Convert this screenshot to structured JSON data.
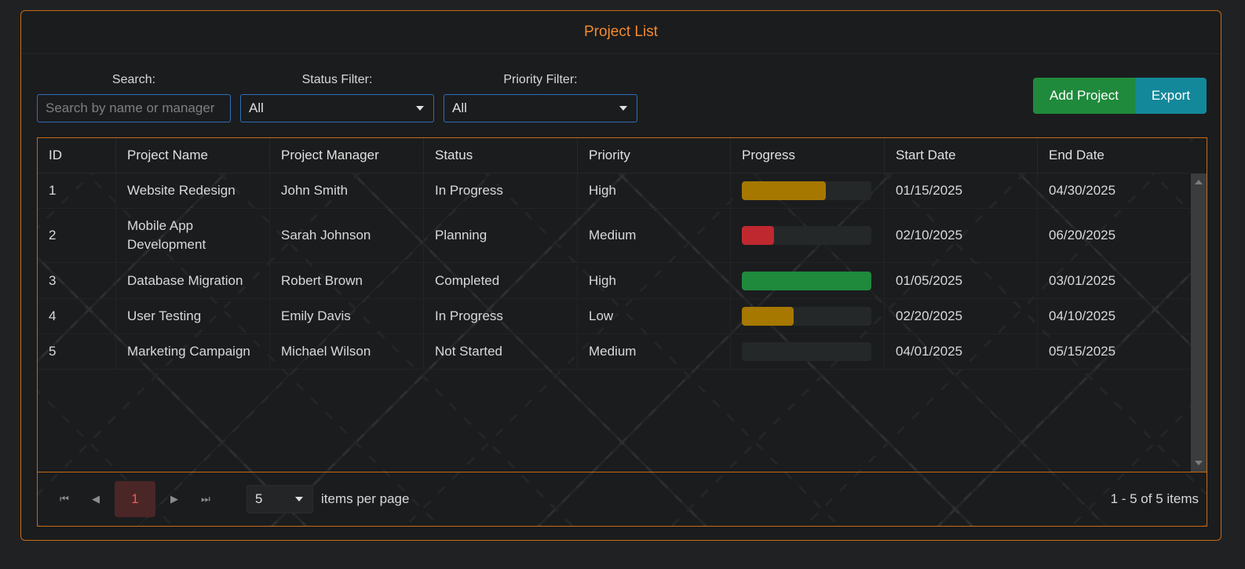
{
  "header": {
    "title": "Project List"
  },
  "filters": {
    "search_label": "Search:",
    "search_placeholder": "Search by name or manager",
    "status_label": "Status Filter:",
    "status_value": "All",
    "priority_label": "Priority Filter:",
    "priority_value": "All"
  },
  "toolbar": {
    "add_label": "Add Project",
    "export_label": "Export"
  },
  "columns": [
    "ID",
    "Project Name",
    "Project Manager",
    "Status",
    "Priority",
    "Progress",
    "Start Date",
    "End Date"
  ],
  "rows": [
    {
      "id": "1",
      "name": "Website Redesign",
      "manager": "John Smith",
      "status": "In Progress",
      "priority": "High",
      "progress": 65,
      "progress_color": "#a67800",
      "start": "01/15/2025",
      "end": "04/30/2025"
    },
    {
      "id": "2",
      "name": "Mobile App Development",
      "manager": "Sarah Johnson",
      "status": "Planning",
      "priority": "Medium",
      "progress": 25,
      "progress_color": "#c0282f",
      "start": "02/10/2025",
      "end": "06/20/2025"
    },
    {
      "id": "3",
      "name": "Database Migration",
      "manager": "Robert Brown",
      "status": "Completed",
      "priority": "High",
      "progress": 100,
      "progress_color": "#1f8a3c",
      "start": "01/05/2025",
      "end": "03/01/2025"
    },
    {
      "id": "4",
      "name": "User Testing",
      "manager": "Emily Davis",
      "status": "In Progress",
      "priority": "Low",
      "progress": 40,
      "progress_color": "#a67800",
      "start": "02/20/2025",
      "end": "04/10/2025"
    },
    {
      "id": "5",
      "name": "Marketing Campaign",
      "manager": "Michael Wilson",
      "status": "Not Started",
      "priority": "Medium",
      "progress": 0,
      "progress_color": "#6c757d",
      "start": "04/01/2025",
      "end": "05/15/2025"
    }
  ],
  "pager": {
    "current_page": "1",
    "page_size": "5",
    "per_page_label": "items per page",
    "info": "1 - 5 of 5 items"
  }
}
